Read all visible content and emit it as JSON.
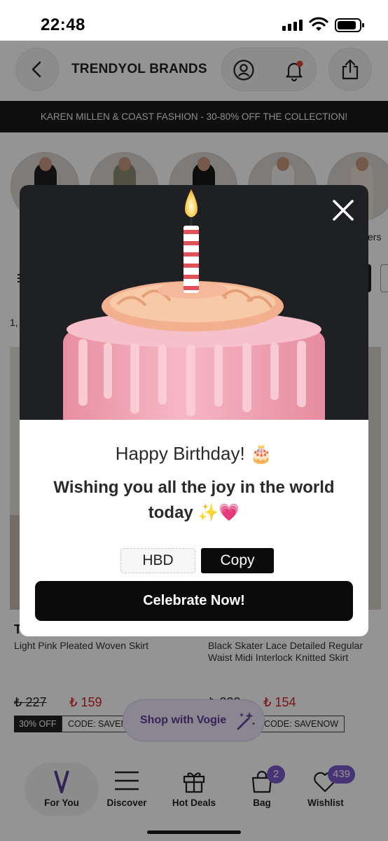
{
  "status_bar": {
    "time": "22:48"
  },
  "header": {
    "title": "TRENDYOL BRANDS"
  },
  "promo_banner": {
    "text": "KAREN MILLEN & COAST FASHION - 30-80% OFF THE COLLECTION!"
  },
  "stories": {
    "partial_label": "ers"
  },
  "listing": {
    "count_partial": "1,"
  },
  "products": [
    {
      "brand_partial": "T",
      "title": "Light Pink Pleated Woven Skirt",
      "old_price": "₺ 227",
      "new_price": "₺ 159",
      "discount_badge": "30% OFF",
      "code_badge": "CODE: SAVEN"
    },
    {
      "title": "Black Skater Lace Detailed Regular Waist Midi Interlock Knitted Skirt",
      "old_price": "₺ 220",
      "new_price": "₺ 154",
      "code_badge": "CODE: SAVENOW"
    }
  ],
  "vogie": {
    "label": "Shop with Vogie"
  },
  "bottom_nav": {
    "items": [
      {
        "label": "For You",
        "icon": "vogie-v-icon"
      },
      {
        "label": "Discover",
        "icon": "menu-lines-icon"
      },
      {
        "label": "Hot Deals",
        "icon": "gift-icon"
      },
      {
        "label": "Bag",
        "icon": "bag-icon",
        "badge": "2"
      },
      {
        "label": "Wishlist",
        "icon": "heart-icon",
        "badge": "439"
      }
    ]
  },
  "modal": {
    "title": "Happy Birthday! 🎂",
    "subtitle": "Wishing you all the joy in the world today ✨💗",
    "coupon_code": "HBD",
    "copy_label": "Copy",
    "cta_label": "Celebrate Now!"
  },
  "colors": {
    "accent_purple": "#7a5acb",
    "price_red": "#d32020",
    "dark": "#0b0b0b",
    "modal_image_bg": "#1f2023",
    "cake_pink": "#f2a9b8"
  }
}
